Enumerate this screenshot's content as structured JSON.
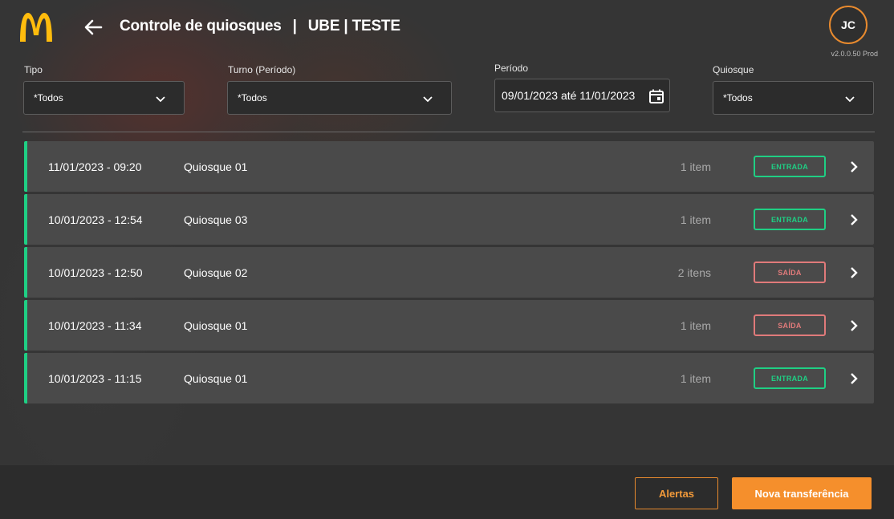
{
  "colors": {
    "accent": "#f58f2c",
    "entrada": "#1fcf84",
    "saida": "#e07a7a",
    "logo": "#ffbc0d"
  },
  "header": {
    "logo_icon": "golden-arches-logo",
    "back_icon": "arrow-left-icon",
    "title": "Controle de quiosques",
    "separator": "|",
    "store": "UBE | TESTE",
    "avatar_initials": "JC",
    "version": "v2.0.0.50 Prod"
  },
  "filters": {
    "tipo": {
      "label": "Tipo",
      "value": "*Todos"
    },
    "turno": {
      "label": "Turno (Período)",
      "value": "*Todos"
    },
    "periodo": {
      "label": "Período",
      "value": "09/01/2023 até 11/01/2023",
      "icon": "calendar-icon"
    },
    "quiosque": {
      "label": "Quiosque",
      "value": "*Todos"
    }
  },
  "rows": [
    {
      "datetime": "11/01/2023 - 09:20",
      "kiosk": "Quiosque 01",
      "items": "1 item",
      "status": "ENTRADA",
      "type": "in"
    },
    {
      "datetime": "10/01/2023 - 12:54",
      "kiosk": "Quiosque 03",
      "items": "1 item",
      "status": "ENTRADA",
      "type": "in"
    },
    {
      "datetime": "10/01/2023 - 12:50",
      "kiosk": "Quiosque 02",
      "items": "2 itens",
      "status": "SAÍDA",
      "type": "out"
    },
    {
      "datetime": "10/01/2023 - 11:34",
      "kiosk": "Quiosque 01",
      "items": "1 item",
      "status": "SAÍDA",
      "type": "out"
    },
    {
      "datetime": "10/01/2023 - 11:15",
      "kiosk": "Quiosque 01",
      "items": "1 item",
      "status": "ENTRADA",
      "type": "in"
    }
  ],
  "footer": {
    "alerts_label": "Alertas",
    "new_transfer_label": "Nova transferência"
  }
}
